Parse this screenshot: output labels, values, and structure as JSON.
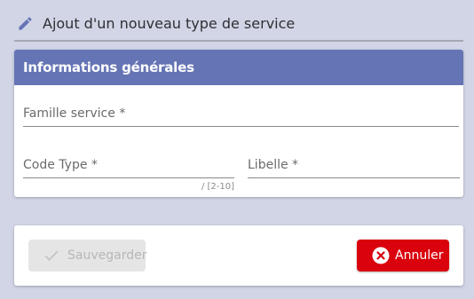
{
  "header": {
    "title": "Ajout d'un nouveau type de service",
    "icon": "pencil-icon"
  },
  "section": {
    "title": "Informations générales",
    "color": "#6574b5"
  },
  "fields": {
    "famille_service": {
      "label": "Famille service *",
      "value": ""
    },
    "code_type": {
      "label": "Code Type *",
      "value": "",
      "hint": "/ [2-10]"
    },
    "libelle": {
      "label": "Libelle *",
      "value": ""
    }
  },
  "actions": {
    "save": {
      "label": "Sauvegarder",
      "icon": "check-icon",
      "disabled": true
    },
    "cancel": {
      "label": "Annuler",
      "icon": "close-circle-icon",
      "color": "#d9020d"
    }
  }
}
